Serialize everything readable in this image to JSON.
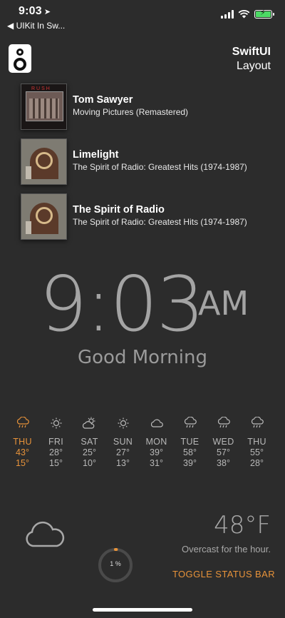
{
  "status_bar": {
    "time": "9:03",
    "back_app": "◀ UIKit In Sw..."
  },
  "header": {
    "title": "SwiftUI",
    "subtitle": "Layout"
  },
  "tracks": [
    {
      "title": "Tom Sawyer",
      "album": "Moving Pictures (Remastered)"
    },
    {
      "title": "Limelight",
      "album": "The Spirit of Radio: Greatest Hits (1974-1987)"
    },
    {
      "title": "The Spirit of Radio",
      "album": "The Spirit of Radio: Greatest Hits (1974-1987)"
    }
  ],
  "clock": {
    "time": "9:03",
    "ampm": "AM",
    "greeting": "Good Morning"
  },
  "forecast": [
    {
      "day": "THU",
      "high": "43°",
      "low": "15°",
      "icon": "rain-icon",
      "today": true
    },
    {
      "day": "FRI",
      "high": "28°",
      "low": "15°",
      "icon": "sun-icon"
    },
    {
      "day": "SAT",
      "high": "25°",
      "low": "10°",
      "icon": "partly-cloudy-icon"
    },
    {
      "day": "SUN",
      "high": "27°",
      "low": "13°",
      "icon": "sun-icon"
    },
    {
      "day": "MON",
      "high": "39°",
      "low": "31°",
      "icon": "cloud-icon"
    },
    {
      "day": "TUE",
      "high": "58°",
      "low": "39°",
      "icon": "rain-icon"
    },
    {
      "day": "WED",
      "high": "57°",
      "low": "38°",
      "icon": "rain-icon"
    },
    {
      "day": "THU",
      "high": "55°",
      "low": "28°",
      "icon": "rain-icon"
    }
  ],
  "current": {
    "temperature": "48°F",
    "condition": "Overcast for the hour.",
    "icon": "cloud-icon"
  },
  "progress": {
    "label": "1 %",
    "value": 0.01
  },
  "toggle_label": "TOGGLE STATUS BAR",
  "colors": {
    "background": "#2c2c2c",
    "accent": "#e8933a",
    "battery": "#4cd964",
    "muted": "#a4a4a4"
  }
}
